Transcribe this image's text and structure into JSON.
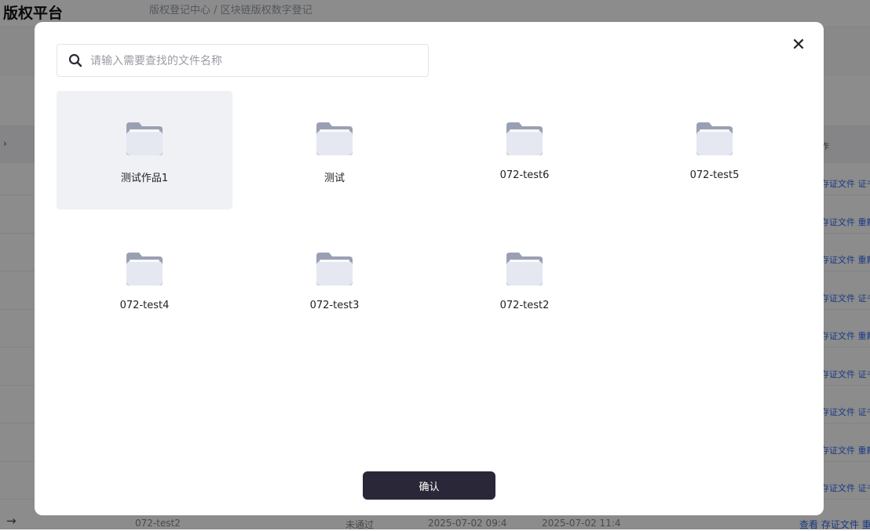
{
  "background": {
    "brand": "版权平台",
    "breadcrumb": "版权登记中心 / 区块链版权数字登记",
    "table_head_fragment": "作",
    "row_links": [
      "存证文件 证书",
      "存证文件 重新",
      "存证文件 重新",
      "存证文件 证书",
      "存证文件 重新",
      "存证文件 证书",
      "存证文件 证书",
      "存证文件 重新",
      "存证文件 证书"
    ],
    "bottom_row": {
      "name": "072-test2",
      "status": "未通过",
      "date1": "2025-07-02 09:4",
      "date2": "2025-07-02 11:4",
      "actions": "查看 存证文件 重新"
    }
  },
  "modal": {
    "close_symbol": "✕",
    "search": {
      "placeholder": "请输入需要查找的文件名称",
      "value": ""
    },
    "folders": [
      {
        "name": "测试作品1",
        "selected": true
      },
      {
        "name": "测试",
        "selected": false
      },
      {
        "name": "072-test6",
        "selected": false
      },
      {
        "name": "072-test5",
        "selected": false
      },
      {
        "name": "072-test4",
        "selected": false
      },
      {
        "name": "072-test3",
        "selected": false
      },
      {
        "name": "072-test2",
        "selected": false
      }
    ],
    "confirm_label": "确认"
  },
  "colors": {
    "overlay": "rgba(0,0,0,0.45)",
    "confirm_button": "#2a2738",
    "selected_item": "#f0f1f5",
    "folder_back": "#9aa0b4",
    "folder_front": "#e6e8f1"
  },
  "icons": {
    "search": "search-icon",
    "close": "close-icon",
    "folder": "folder-icon"
  }
}
